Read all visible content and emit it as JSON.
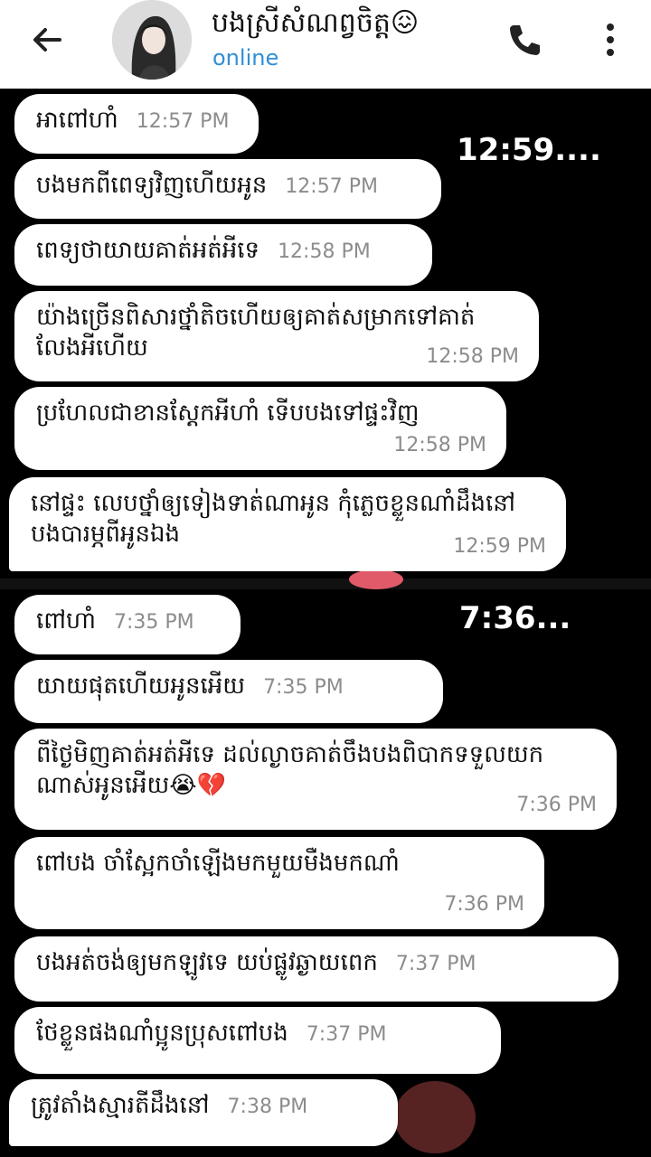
{
  "header": {
    "contact_name": "បងស្រីសំណព្វចិត្ត😖",
    "status": "online"
  },
  "timestamps": {
    "first": "12:59....",
    "second": "7:36..."
  },
  "messages_1": [
    {
      "text": "អាពៅហាំ",
      "time": "12:57 PM"
    },
    {
      "text": "បងមកពីពេទ្យវិញហើយអូន",
      "time": "12:57 PM"
    },
    {
      "text": "ពេទ្យថាយាយគាត់អត់អីទេ",
      "time": "12:58 PM"
    },
    {
      "text": "យ៉ាងច្រើនពិសារថ្នាំតិចហើយឲ្យគាត់សម្រាកទៅគាត់លែងអីហើយ",
      "time": "12:58 PM"
    },
    {
      "text": "ប្រហែលជាខានស្ដែកអីហាំ ទើបបងទៅផ្ទះវិញ",
      "time": "12:58 PM"
    },
    {
      "text": "នៅផ្ទះ លេបថ្នាំឲ្យទៀងទាត់ណាអូន កុំភ្លេចខ្លួនណាំដឹងនៅ បងបារម្ភពីអូនឯង",
      "time": "12:59 PM"
    }
  ],
  "messages_2": [
    {
      "text": "ពៅហាំ",
      "time": "7:35 PM"
    },
    {
      "text": "យាយផុតហើយអូនអើយ",
      "time": "7:35 PM"
    },
    {
      "text": "ពីថ្ងៃមិញគាត់អត់អីទេ ដល់ល្ងាចគាត់ចឹងបងពិបាកទទួលយកណាស់អូនអើយ😭💔",
      "time": "7:36 PM"
    },
    {
      "text": "ពៅបង ចាំស្អែកចាំឡើងមកមួយមឺងមកណាំ",
      "time": "7:36 PM"
    },
    {
      "text": "បងអត់ចង់ឲ្យមកឡូវទេ យប់ផ្លូវឆ្ងាយពេក",
      "time": "7:37 PM"
    },
    {
      "text": "ថែខ្លួនផងណាំប្អូនប្រុសពៅបង",
      "time": "7:37 PM"
    },
    {
      "text": "ត្រូវតាំងស្មារតីដឹងនៅ",
      "time": "7:38 PM"
    }
  ]
}
